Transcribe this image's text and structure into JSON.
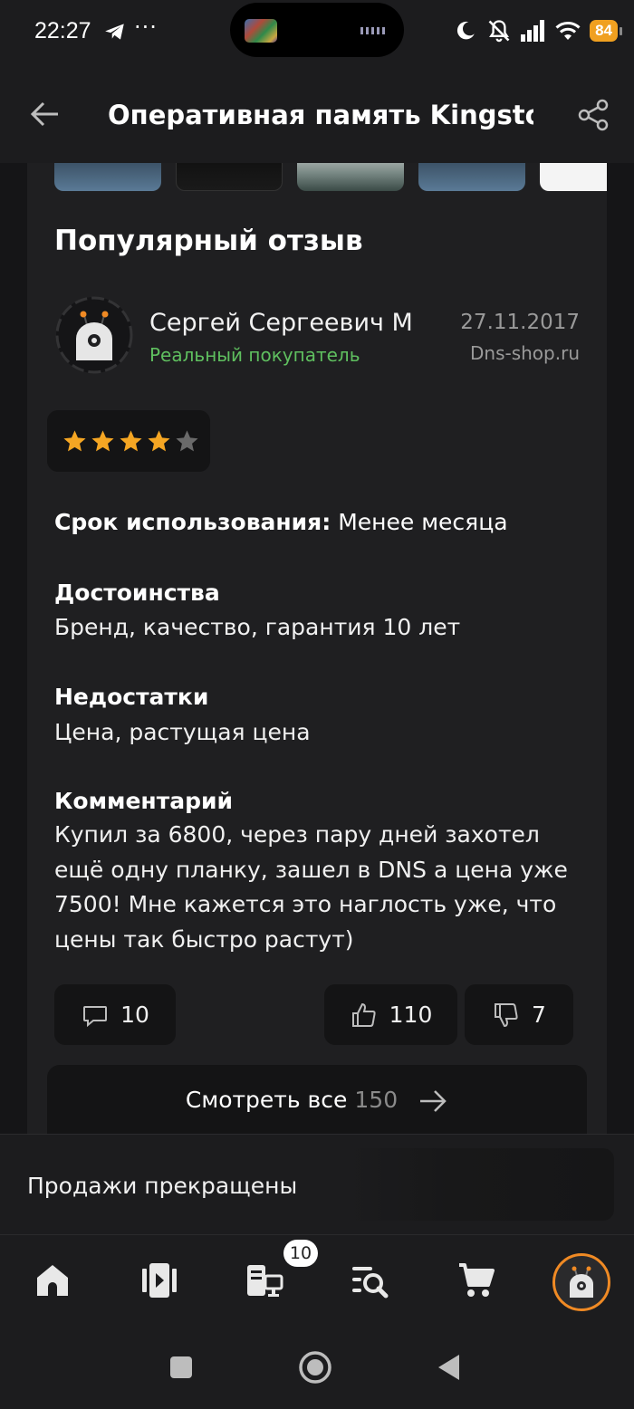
{
  "status_bar": {
    "time": "22:27",
    "more_indicator": "···",
    "battery": "84",
    "icons": [
      "telegram-icon",
      "moon-icon",
      "mute-icon",
      "signal-icon",
      "wifi-icon",
      "battery-icon"
    ]
  },
  "header": {
    "title": "Оперативная память Kingsto...",
    "back_icon": "arrow-left-icon",
    "share_icon": "share-icon"
  },
  "review": {
    "section_title": "Популярный отзыв",
    "author_name": "Сергей Сергеевич М",
    "author_badge": "Реальный покупатель",
    "date": "27.11.2017",
    "source": "Dns-shop.ru",
    "rating": 4,
    "rating_max": 5,
    "usage_label": "Срок использования:",
    "usage_value": "Менее месяца",
    "pros_label": "Достоинства",
    "pros_value": "Бренд, качество, гарантия 10 лет",
    "cons_label": "Недостатки",
    "cons_value": "Цена, растущая цена",
    "comment_label": "Комментарий",
    "comment_value": "Купил за 6800, через пару дней захотел ещё одну планку, зашел в DNS а цена уже 7500! Мне кажется это наглость уже, что цены так быстро растут)",
    "comments_count": "10",
    "likes_count": "110",
    "dislikes_count": "7"
  },
  "see_all": {
    "label": "Смотреть все",
    "count": "150"
  },
  "sales": {
    "status": "Продажи прекращены"
  },
  "bottom_nav": {
    "items": [
      "home-icon",
      "catalog-icon",
      "compare-icon",
      "search-list-icon",
      "cart-icon",
      "profile-icon"
    ],
    "compare_badge": "10"
  },
  "colors": {
    "accent": "#f08a24",
    "verified": "#5fbf5f",
    "background": "#151517",
    "card": "#1f1f21",
    "star": "#f5a623"
  }
}
